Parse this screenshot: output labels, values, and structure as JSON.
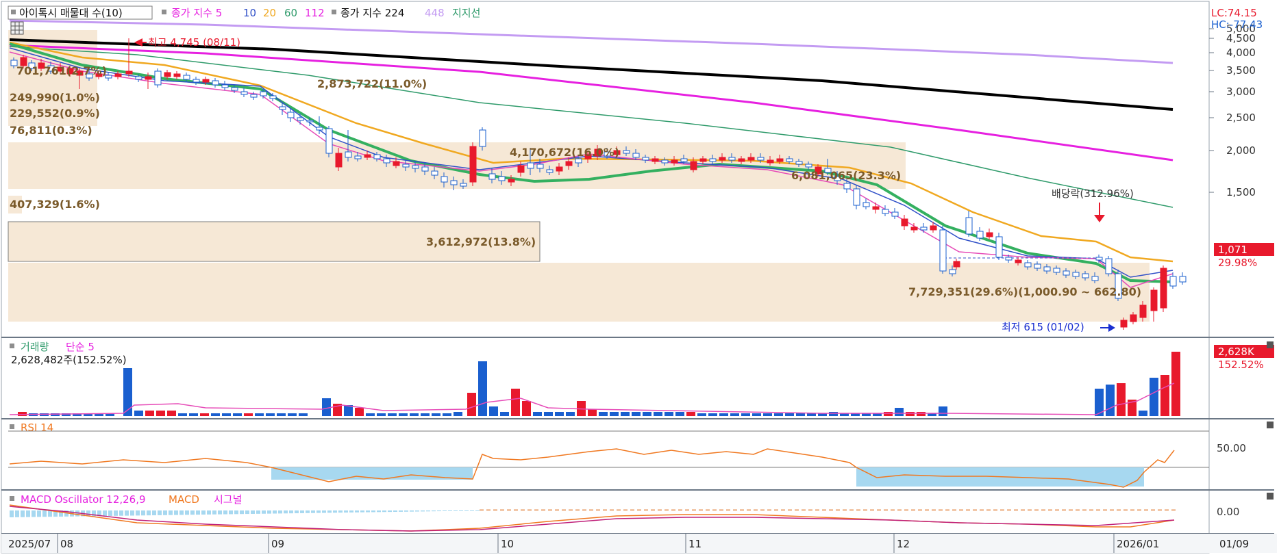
{
  "main_panel": {
    "legend_box_label": "아이톡시 매물대 수(10)",
    "legend_ma_prefix": "종가 지수 5",
    "legend_ma_10": "10",
    "legend_ma_20": "20",
    "legend_ma_60": "60",
    "legend_ma_112": "112",
    "legend_long_prefix": "종가 지수 224",
    "legend_long_448": "448",
    "legend_support": "지지선",
    "lc_label": "LC:74.15",
    "hc_label": "HC:-77.43",
    "y_ticks": [
      "5,000",
      "4,500",
      "4,000",
      "3,500",
      "3,000",
      "2,500",
      "2,000",
      "1,500"
    ],
    "current_price_label": "1,071",
    "current_change_label": "29.98%",
    "high_annotation": "최고 4,745 (08/11)",
    "low_annotation": "최저 615 (01/02)",
    "dividend_annotation": "배당락(312.96%)",
    "volume_profile_labels": [
      "701,761(2.7%)",
      "249,990(1.0%)",
      "229,552(0.9%)",
      "76,811(0.3%)",
      "2,873,722(11.0%)",
      "4,170,672(16.0%)",
      "6,081,065(23.3%)",
      "407,329(1.6%)",
      "3,612,972(13.8%)",
      "7,729,351(29.6%)(1,000.90 ~ 662.80)"
    ],
    "colors": {
      "up": "#e8192c",
      "down": "#1a5fcf",
      "ma5": "#e64cb8",
      "ma10": "#3050c8",
      "ma20": "#f0a820",
      "ma60": "#2e9a6a",
      "ma112": "#34b060",
      "ma224": "#e620e0",
      "ma448": "#c39bf2",
      "support": "#000000",
      "profile_fill": "#f6e8d6"
    }
  },
  "volume_panel": {
    "title": "거래량",
    "ma_label": "단순 5",
    "value_label": "2,628,482주(152.52%)",
    "right_value": "2,628K",
    "right_pct": "152.52%"
  },
  "rsi_panel": {
    "title": "RSI 14",
    "tick": "50.00"
  },
  "macd_panel": {
    "title": "MACD Oscillator 12,26,9",
    "macd_label": "MACD",
    "signal_label": "시그널",
    "tick": "0.00"
  },
  "x_axis": {
    "labels": [
      "2025/07",
      "08",
      "09",
      "10",
      "11",
      "12",
      "2026/01",
      "01/09"
    ]
  },
  "chart_data": {
    "type": "candlestick",
    "price_axis_ticks": [
      5000,
      4500,
      4000,
      3500,
      3000,
      2500,
      2000,
      1500
    ],
    "price_range": [
      615,
      4745
    ],
    "high": {
      "value": 4745,
      "date": "08/11"
    },
    "low": {
      "value": 615,
      "date": "01/02"
    },
    "last_close": 1071,
    "last_change_pct": 29.98,
    "volume_last": 2628482,
    "volume_last_pct": 152.52,
    "rsi_period": 14,
    "rsi_reference": 50.0,
    "macd_params": [
      12,
      26,
      9
    ],
    "moving_averages": [
      5,
      10,
      20,
      60,
      112,
      224,
      448
    ],
    "volume_profile_bins": 10
  }
}
